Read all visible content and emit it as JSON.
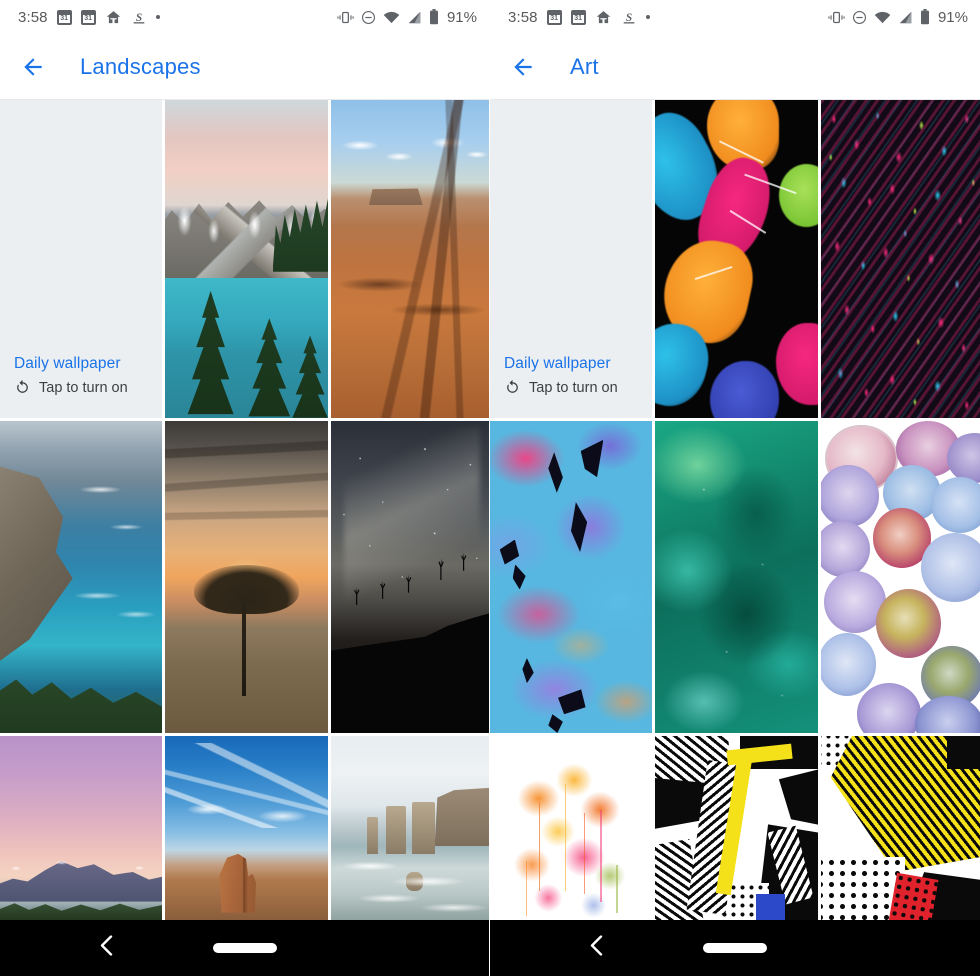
{
  "screens": [
    {
      "id": "landscapes",
      "status_bar": {
        "time": "3:58",
        "icons_left": [
          "calendar-icon",
          "calendar-icon",
          "home-icon",
          "s-app-icon",
          "dot-icon"
        ],
        "calendar_day": "31",
        "app_letter": "S",
        "icons_right": [
          "vibrate-icon",
          "do-not-disturb-icon",
          "wifi-icon",
          "signal-icon",
          "battery-icon"
        ],
        "battery_percent": "91%"
      },
      "app_bar": {
        "back_icon": "back-arrow-icon",
        "title": "Landscapes"
      },
      "daily_card": {
        "title": "Daily wallpaper",
        "refresh_icon": "refresh-icon",
        "subtitle": "Tap to turn on"
      },
      "tiles": [
        {
          "position": "row1-col2",
          "name": "mountain-lake-wallpaper"
        },
        {
          "position": "row1-col3",
          "name": "desert-canyon-wallpaper"
        },
        {
          "position": "row2-col1",
          "name": "coastal-cliffs-wallpaper"
        },
        {
          "position": "row2-col2",
          "name": "acacia-tree-sunset-wallpaper"
        },
        {
          "position": "row2-col3",
          "name": "starry-night-desert-wallpaper"
        },
        {
          "position": "row3-col1",
          "name": "purple-dusk-mountains-wallpaper"
        },
        {
          "position": "row3-col2",
          "name": "monument-valley-wallpaper"
        },
        {
          "position": "row3-col3",
          "name": "sea-stacks-wallpaper"
        }
      ],
      "nav_bar": {
        "back_icon": "nav-back-icon",
        "home_pill": "nav-home-pill"
      }
    },
    {
      "id": "art",
      "status_bar": {
        "time": "3:58",
        "icons_left": [
          "calendar-icon",
          "calendar-icon",
          "home-icon",
          "s-app-icon",
          "dot-icon"
        ],
        "calendar_day": "31",
        "app_letter": "S",
        "icons_right": [
          "vibrate-icon",
          "do-not-disturb-icon",
          "wifi-icon",
          "signal-icon",
          "battery-icon"
        ],
        "battery_percent": "91%"
      },
      "app_bar": {
        "back_icon": "back-arrow-icon",
        "title": "Art"
      },
      "daily_card": {
        "title": "Daily wallpaper",
        "refresh_icon": "refresh-icon",
        "subtitle": "Tap to turn on"
      },
      "tiles": [
        {
          "position": "row1-col2",
          "name": "paint-splatter-black-wallpaper"
        },
        {
          "position": "row1-col3",
          "name": "neon-confetti-wallpaper"
        },
        {
          "position": "row2-col1",
          "name": "pink-blue-watercolor-wallpaper"
        },
        {
          "position": "row2-col2",
          "name": "green-watercolor-wallpaper"
        },
        {
          "position": "row2-col3",
          "name": "ink-blooms-wallpaper"
        },
        {
          "position": "row3-col1",
          "name": "orange-splash-wallpaper"
        },
        {
          "position": "row3-col2",
          "name": "pop-art-stripes-wallpaper"
        },
        {
          "position": "row3-col3",
          "name": "pop-art-yellow-wallpaper"
        }
      ],
      "nav_bar": {
        "back_icon": "nav-back-icon",
        "home_pill": "nav-home-pill"
      }
    }
  ],
  "theme": {
    "accent": "#1a73e8",
    "card_bg": "#eceff1",
    "nav_bg": "#000000",
    "status_text": "#5f6368",
    "subtitle_text": "#3c4043"
  }
}
